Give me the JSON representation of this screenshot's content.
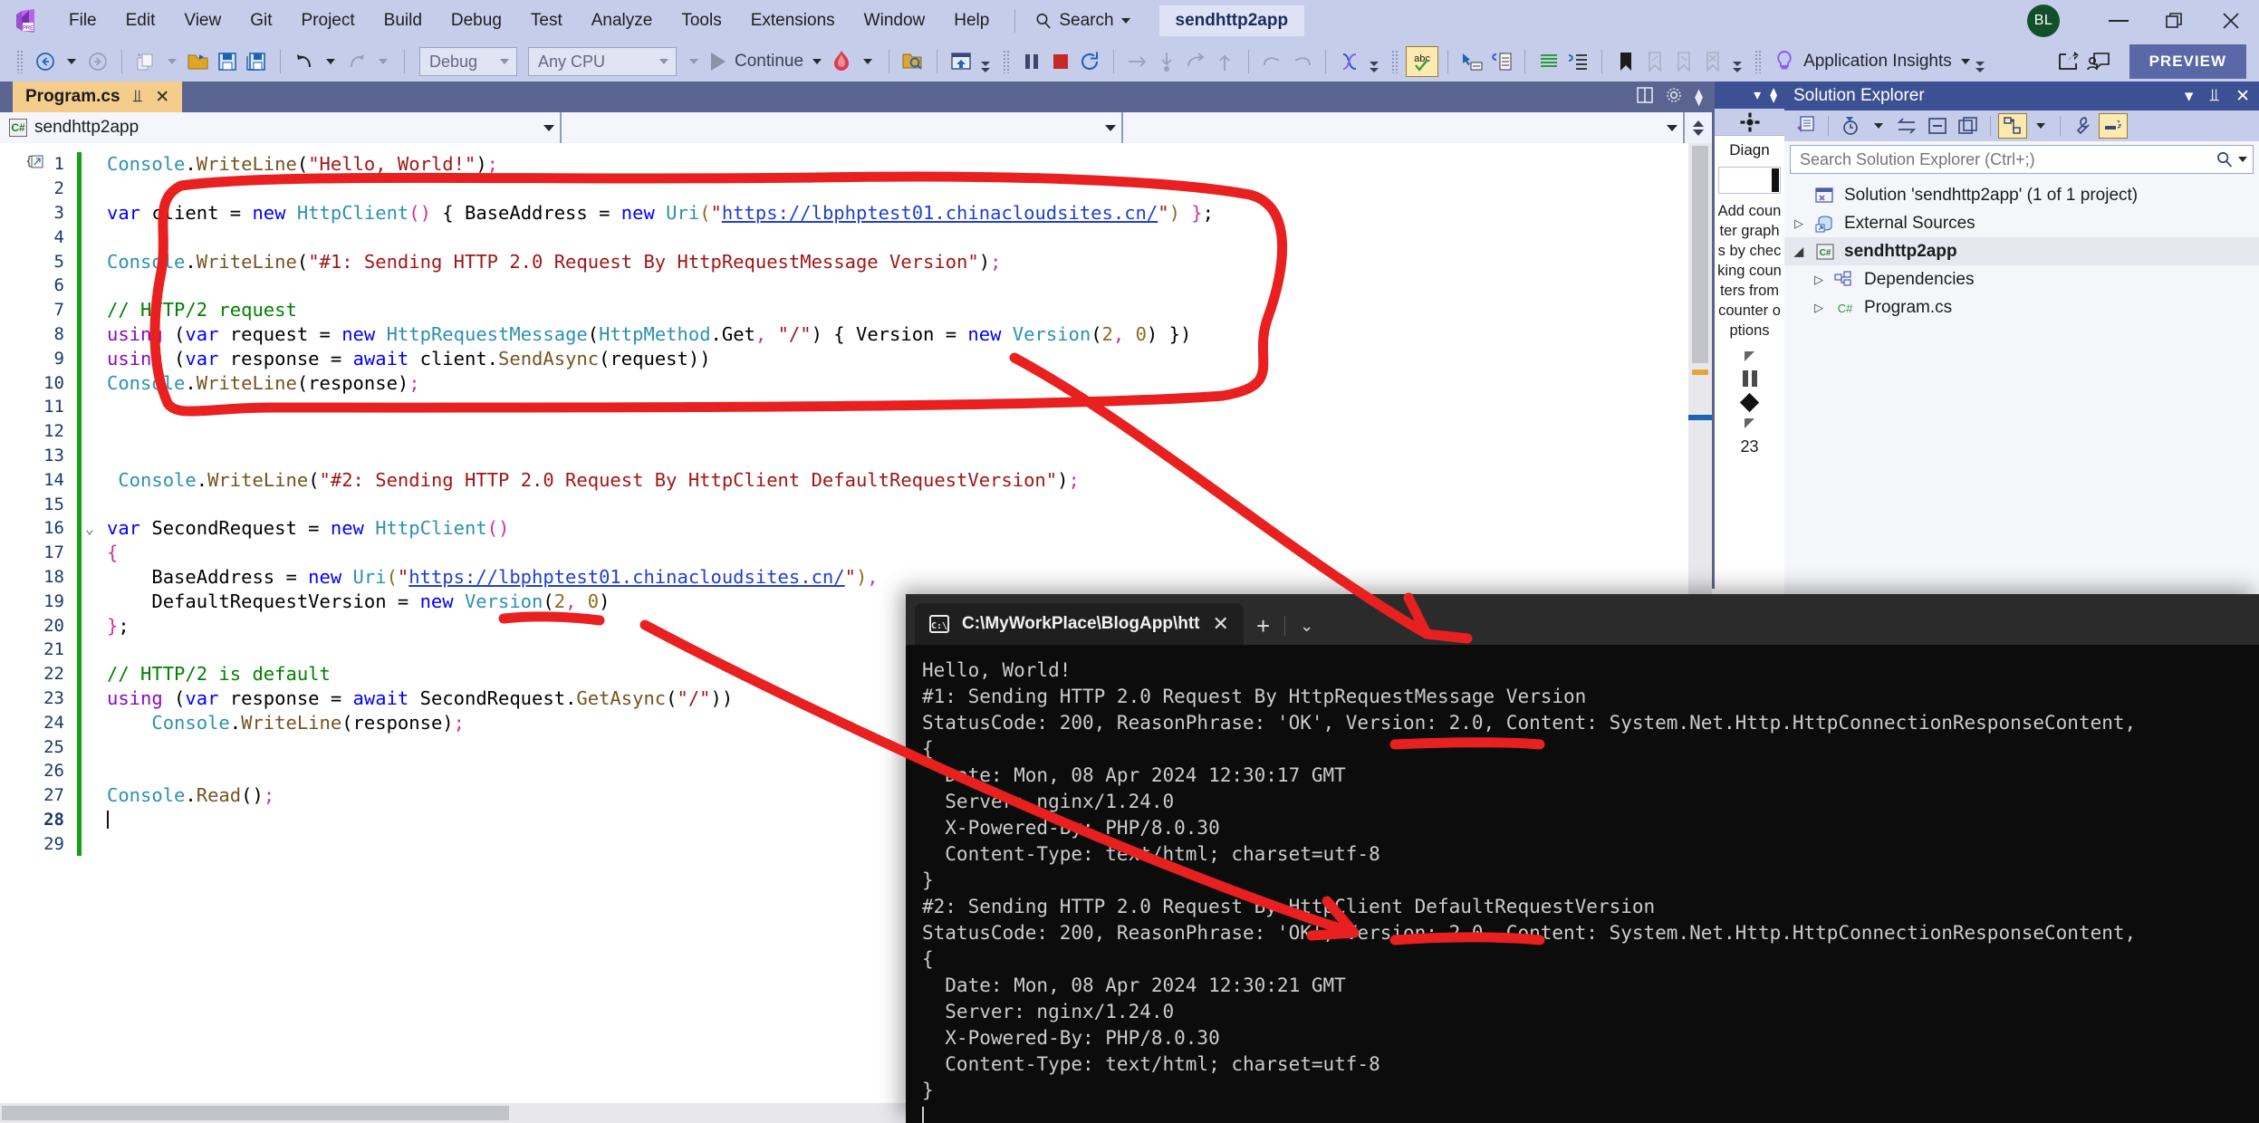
{
  "titlebar": {
    "menus": [
      "File",
      "Edit",
      "View",
      "Git",
      "Project",
      "Build",
      "Debug",
      "Test",
      "Analyze",
      "Tools",
      "Extensions",
      "Window",
      "Help"
    ],
    "search_label": "Search",
    "solution_chip": "sendhttp2app",
    "avatar_initials": "BL",
    "minimize": "—",
    "maximize": "❐",
    "close": "✕"
  },
  "toolbar": {
    "config_value": "Debug",
    "platform_value": "Any CPU",
    "continue_label": "Continue",
    "app_insights_label": "Application Insights",
    "preview_label": "PREVIEW"
  },
  "document": {
    "tab_label": "Program.cs",
    "pin_glyph": "⫫",
    "close_glyph": "✕",
    "nav_project": "sendhttp2app",
    "nav_type": "",
    "nav_member": ""
  },
  "editor": {
    "lines": [
      {
        "n": "1",
        "fold": "",
        "tokens": [
          {
            "t": "Console",
            "c": "t"
          },
          {
            "t": ".",
            "c": "n"
          },
          {
            "t": "WriteLine",
            "c": "m"
          },
          {
            "t": "(",
            "c": "n"
          },
          {
            "t": "\"Hello, World!\"",
            "c": "s"
          },
          {
            "t": ")",
            "c": "n"
          },
          {
            "t": ";",
            "c": "p"
          }
        ]
      },
      {
        "n": "2",
        "fold": "",
        "tokens": []
      },
      {
        "n": "3",
        "fold": "",
        "tokens": [
          {
            "t": "var",
            "c": "k"
          },
          {
            "t": " client ",
            "c": "n"
          },
          {
            "t": "=",
            "c": "n"
          },
          {
            "t": " ",
            "c": "n"
          },
          {
            "t": "new",
            "c": "k"
          },
          {
            "t": " ",
            "c": "n"
          },
          {
            "t": "HttpClient",
            "c": "t"
          },
          {
            "t": "()",
            "c": "p"
          },
          {
            "t": " { BaseAddress ",
            "c": "n"
          },
          {
            "t": "=",
            "c": "n"
          },
          {
            "t": " ",
            "c": "n"
          },
          {
            "t": "new",
            "c": "k"
          },
          {
            "t": " ",
            "c": "n"
          },
          {
            "t": "Uri",
            "c": "t"
          },
          {
            "t": "(",
            "c": "num"
          },
          {
            "t": "\"",
            "c": "s"
          },
          {
            "t": "https://lbphptest01.chinacloudsites.cn/",
            "c": "lnk"
          },
          {
            "t": "\"",
            "c": "s"
          },
          {
            "t": ")",
            "c": "num"
          },
          {
            "t": " }",
            "c": "p"
          },
          {
            "t": ";",
            "c": "n"
          }
        ]
      },
      {
        "n": "4",
        "fold": "",
        "tokens": []
      },
      {
        "n": "5",
        "fold": "",
        "tokens": [
          {
            "t": "Console",
            "c": "t"
          },
          {
            "t": ".",
            "c": "n"
          },
          {
            "t": "WriteLine",
            "c": "m"
          },
          {
            "t": "(",
            "c": "n"
          },
          {
            "t": "\"#1: Sending HTTP 2.0 Request By HttpRequestMessage Version\"",
            "c": "s"
          },
          {
            "t": ")",
            "c": "n"
          },
          {
            "t": ";",
            "c": "p"
          }
        ]
      },
      {
        "n": "6",
        "fold": "",
        "tokens": []
      },
      {
        "n": "7",
        "fold": "",
        "tokens": [
          {
            "t": "// HTTP/2 request",
            "c": "c"
          }
        ]
      },
      {
        "n": "8",
        "fold": "",
        "tokens": [
          {
            "t": "using",
            "c": "ctrl"
          },
          {
            "t": " (",
            "c": "n"
          },
          {
            "t": "var",
            "c": "k"
          },
          {
            "t": " request ",
            "c": "n"
          },
          {
            "t": "=",
            "c": "n"
          },
          {
            "t": " ",
            "c": "n"
          },
          {
            "t": "new",
            "c": "k"
          },
          {
            "t": " ",
            "c": "n"
          },
          {
            "t": "HttpRequestMessage",
            "c": "t"
          },
          {
            "t": "(",
            "c": "n"
          },
          {
            "t": "HttpMethod",
            "c": "t"
          },
          {
            "t": ".",
            "c": "n"
          },
          {
            "t": "Get",
            "c": "n"
          },
          {
            "t": ", ",
            "c": "p"
          },
          {
            "t": "\"/\"",
            "c": "s"
          },
          {
            "t": ") { Version ",
            "c": "n"
          },
          {
            "t": "=",
            "c": "n"
          },
          {
            "t": " ",
            "c": "n"
          },
          {
            "t": "new",
            "c": "k"
          },
          {
            "t": " ",
            "c": "n"
          },
          {
            "t": "Version",
            "c": "t"
          },
          {
            "t": "(",
            "c": "n"
          },
          {
            "t": "2",
            "c": "num"
          },
          {
            "t": ", ",
            "c": "p"
          },
          {
            "t": "0",
            "c": "num"
          },
          {
            "t": ") })",
            "c": "n"
          }
        ]
      },
      {
        "n": "9",
        "fold": "",
        "tokens": [
          {
            "t": "using",
            "c": "ctrl"
          },
          {
            "t": " (",
            "c": "n"
          },
          {
            "t": "var",
            "c": "k"
          },
          {
            "t": " response ",
            "c": "n"
          },
          {
            "t": "=",
            "c": "n"
          },
          {
            "t": " ",
            "c": "n"
          },
          {
            "t": "await",
            "c": "k"
          },
          {
            "t": " client",
            "c": "n"
          },
          {
            "t": ".",
            "c": "n"
          },
          {
            "t": "SendAsync",
            "c": "m"
          },
          {
            "t": "(request))",
            "c": "n"
          }
        ]
      },
      {
        "n": "10",
        "fold": "",
        "tokens": [
          {
            "t": "Console",
            "c": "t"
          },
          {
            "t": ".",
            "c": "n"
          },
          {
            "t": "WriteLine",
            "c": "m"
          },
          {
            "t": "(response)",
            "c": "n"
          },
          {
            "t": ";",
            "c": "p"
          }
        ]
      },
      {
        "n": "11",
        "fold": "",
        "tokens": []
      },
      {
        "n": "12",
        "fold": "",
        "tokens": []
      },
      {
        "n": "13",
        "fold": "",
        "tokens": []
      },
      {
        "n": "14",
        "fold": "",
        "tokens": [
          {
            "t": " Console",
            "c": "t"
          },
          {
            "t": ".",
            "c": "n"
          },
          {
            "t": "WriteLine",
            "c": "m"
          },
          {
            "t": "(",
            "c": "n"
          },
          {
            "t": "\"#2: Sending HTTP 2.0 Request By HttpClient DefaultRequestVersion\"",
            "c": "s"
          },
          {
            "t": ")",
            "c": "n"
          },
          {
            "t": ";",
            "c": "p"
          }
        ]
      },
      {
        "n": "15",
        "fold": "",
        "tokens": []
      },
      {
        "n": "16",
        "fold": "⌄",
        "tokens": [
          {
            "t": "var",
            "c": "k"
          },
          {
            "t": " SecondRequest ",
            "c": "n"
          },
          {
            "t": "=",
            "c": "n"
          },
          {
            "t": " ",
            "c": "n"
          },
          {
            "t": "new",
            "c": "k"
          },
          {
            "t": " ",
            "c": "n"
          },
          {
            "t": "HttpClient",
            "c": "t"
          },
          {
            "t": "()",
            "c": "p"
          }
        ]
      },
      {
        "n": "17",
        "fold": "",
        "tokens": [
          {
            "t": "{",
            "c": "p"
          }
        ]
      },
      {
        "n": "18",
        "fold": "",
        "tokens": [
          {
            "t": "    BaseAddress ",
            "c": "n"
          },
          {
            "t": "=",
            "c": "n"
          },
          {
            "t": " ",
            "c": "n"
          },
          {
            "t": "new",
            "c": "k"
          },
          {
            "t": " ",
            "c": "n"
          },
          {
            "t": "Uri",
            "c": "t"
          },
          {
            "t": "(",
            "c": "num"
          },
          {
            "t": "\"",
            "c": "s"
          },
          {
            "t": "https://lbphptest01.chinacloudsites.cn/",
            "c": "lnk"
          },
          {
            "t": "\"",
            "c": "s"
          },
          {
            "t": ")",
            "c": "num"
          },
          {
            "t": ",",
            "c": "p"
          }
        ]
      },
      {
        "n": "19",
        "fold": "",
        "tokens": [
          {
            "t": "    DefaultRequestVersion ",
            "c": "n"
          },
          {
            "t": "=",
            "c": "n"
          },
          {
            "t": " ",
            "c": "n"
          },
          {
            "t": "new",
            "c": "k"
          },
          {
            "t": " ",
            "c": "n"
          },
          {
            "t": "Version",
            "c": "t"
          },
          {
            "t": "(",
            "c": "n"
          },
          {
            "t": "2",
            "c": "num"
          },
          {
            "t": ", ",
            "c": "p"
          },
          {
            "t": "0",
            "c": "num"
          },
          {
            "t": ")",
            "c": "n"
          }
        ]
      },
      {
        "n": "20",
        "fold": "",
        "tokens": [
          {
            "t": "}",
            "c": "p"
          },
          {
            "t": ";",
            "c": "n"
          }
        ]
      },
      {
        "n": "21",
        "fold": "",
        "tokens": []
      },
      {
        "n": "22",
        "fold": "",
        "tokens": [
          {
            "t": "// HTTP/2 is default",
            "c": "c"
          }
        ]
      },
      {
        "n": "23",
        "fold": "",
        "tokens": [
          {
            "t": "using",
            "c": "ctrl"
          },
          {
            "t": " (",
            "c": "n"
          },
          {
            "t": "var",
            "c": "k"
          },
          {
            "t": " response ",
            "c": "n"
          },
          {
            "t": "=",
            "c": "n"
          },
          {
            "t": " ",
            "c": "n"
          },
          {
            "t": "await",
            "c": "k"
          },
          {
            "t": " SecondRequest",
            "c": "n"
          },
          {
            "t": ".",
            "c": "n"
          },
          {
            "t": "GetAsync",
            "c": "m"
          },
          {
            "t": "(",
            "c": "n"
          },
          {
            "t": "\"/\"",
            "c": "s"
          },
          {
            "t": "))",
            "c": "n"
          }
        ]
      },
      {
        "n": "24",
        "fold": "",
        "tokens": [
          {
            "t": "    Console",
            "c": "t"
          },
          {
            "t": ".",
            "c": "n"
          },
          {
            "t": "WriteLine",
            "c": "m"
          },
          {
            "t": "(response)",
            "c": "n"
          },
          {
            "t": ";",
            "c": "p"
          }
        ]
      },
      {
        "n": "25",
        "fold": "",
        "tokens": []
      },
      {
        "n": "26",
        "fold": "",
        "tokens": []
      },
      {
        "n": "27",
        "fold": "",
        "tokens": [
          {
            "t": "Console",
            "c": "t"
          },
          {
            "t": ".",
            "c": "n"
          },
          {
            "t": "Read",
            "c": "m"
          },
          {
            "t": "()",
            "c": "n"
          },
          {
            "t": ";",
            "c": "p"
          }
        ]
      },
      {
        "n": "28",
        "fold": "",
        "tokens": []
      },
      {
        "n": "29",
        "fold": "",
        "tokens": []
      }
    ],
    "current_line": "28"
  },
  "diagnostics": {
    "title_clipped": "Diagn",
    "hint_text": "Add counter graphs by checking counters from counter options",
    "value": "23"
  },
  "solution_explorer": {
    "title": "Solution Explorer",
    "collapse_glyph": "▾",
    "pin_glyph": "⫫",
    "close_glyph": "✕",
    "search_placeholder": "Search Solution Explorer (Ctrl+;)",
    "tree": [
      {
        "label": "Solution 'sendhttp2app' (1 of 1 project)",
        "indent": 0,
        "arrow": "",
        "icon": "solution-icon",
        "selected": false
      },
      {
        "label": "External Sources",
        "indent": 0,
        "arrow": "▷",
        "icon": "external-sources-icon",
        "selected": false
      },
      {
        "label": "sendhttp2app",
        "indent": 0,
        "arrow": "◢",
        "icon": "csharp-project-icon",
        "selected": true
      },
      {
        "label": "Dependencies",
        "indent": 1,
        "arrow": "▷",
        "icon": "dependencies-icon",
        "selected": false
      },
      {
        "label": "Program.cs",
        "indent": 1,
        "arrow": "▷",
        "icon": "csharp-file-icon",
        "selected": false
      }
    ]
  },
  "terminal": {
    "tab_title": "C:\\MyWorkPlace\\BlogApp\\htt",
    "tab_close": "✕",
    "new_tab": "+",
    "dropdown": "⌄",
    "output": [
      "Hello, World!",
      "#1: Sending HTTP 2.0 Request By HttpRequestMessage Version",
      "StatusCode: 200, ReasonPhrase: 'OK', Version: 2.0, Content: System.Net.Http.HttpConnectionResponseContent,",
      "{",
      "  Date: Mon, 08 Apr 2024 12:30:17 GMT",
      "  Server: nginx/1.24.0",
      "  X-Powered-By: PHP/8.0.30",
      "  Content-Type: text/html; charset=utf-8",
      "}",
      "#2: Sending HTTP 2.0 Request By HttpClient DefaultRequestVersion",
      "StatusCode: 200, ReasonPhrase: 'OK', Version: 2.0, Content: System.Net.Http.HttpConnectionResponseContent,",
      "{",
      "  Date: Mon, 08 Apr 2024 12:30:21 GMT",
      "  Server: nginx/1.24.0",
      "  X-Powered-By: PHP/8.0.30",
      "  Content-Type: text/html; charset=utf-8",
      "}"
    ]
  },
  "annotations": {
    "color": "#e8201f",
    "shapes": [
      "code-block-circle",
      "arrow-to-console-line1",
      "arrow-to-console-line2",
      "underline-version-1",
      "underline-version-2",
      "underline-line20"
    ]
  }
}
